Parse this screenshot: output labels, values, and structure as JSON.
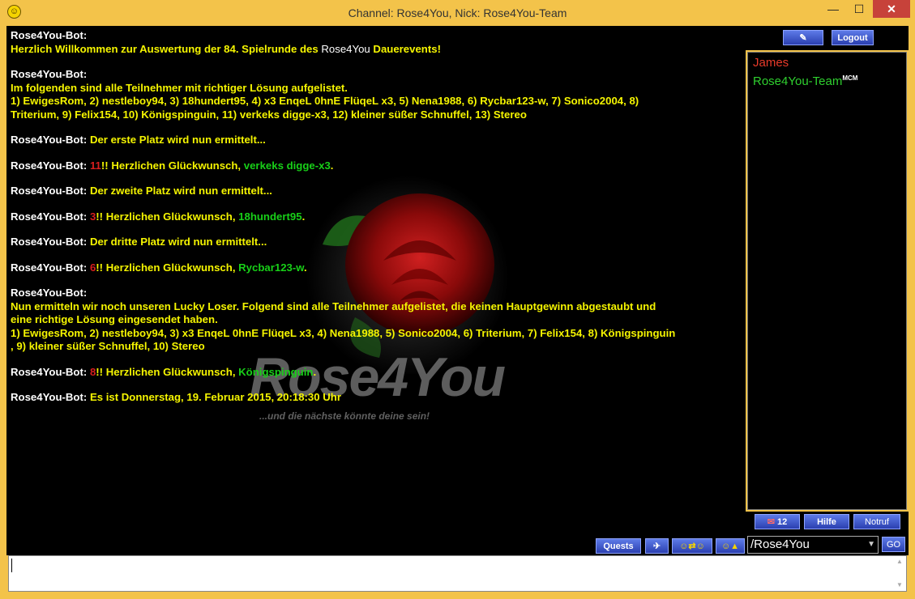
{
  "window": {
    "title": "Channel: Rose4You,  Nick: Rose4You-Team",
    "app_icon": "smiley-icon"
  },
  "window_controls": {
    "minimize": "—",
    "maximize": "☐",
    "close": "✕"
  },
  "chat": {
    "m1": {
      "sender": "Rose4You-Bot:",
      "t1": "Herzlich Willkommen zur Auswertung der  84. Spielrunde des ",
      "brand": "Rose4You",
      "t2": " Dauerevents!"
    },
    "m2": {
      "sender": "Rose4You-Bot:",
      "l1": "Im folgenden sind alle Teilnehmer mit richtiger Lösung aufgelistet.",
      "l2": "1) EwigesRom, 2) nestleboy94, 3) 18hundert95, 4) x3 EnqeL 0hnE FlüqeL x3, 5) Nena1988, 6) Rycbar123-w, 7) Sonico2004, 8)",
      "l3": "Triterium, 9) Felix154, 10) Königspinguin, 11) verkeks digge-x3, 12) kleiner süßer Schnuffel, 13) Stereo"
    },
    "m3": {
      "sender": "Rose4You-Bot: ",
      "text": "Der erste Platz wird nun ermittelt..."
    },
    "m4": {
      "sender": "Rose4You-Bot: ",
      "num": "11",
      "text": "!! Herzlichen Glückwunsch, ",
      "winner": "verkeks digge-x3",
      "end": "."
    },
    "m5": {
      "sender": "Rose4You-Bot: ",
      "text": "Der zweite Platz wird nun ermittelt..."
    },
    "m6": {
      "sender": "Rose4You-Bot: ",
      "num": "3",
      "text": "!! Herzlichen Glückwunsch, ",
      "winner": "18hundert95",
      "end": "."
    },
    "m7": {
      "sender": "Rose4You-Bot: ",
      "text": "Der dritte Platz wird nun ermittelt..."
    },
    "m8": {
      "sender": "Rose4You-Bot: ",
      "num": "6",
      "text": "!! Herzlichen Glückwunsch, ",
      "winner": "Rycbar123-w",
      "end": "."
    },
    "m9": {
      "sender": "Rose4You-Bot:",
      "l1": "Nun ermitteln wir noch unseren Lucky Loser. Folgend sind alle Teilnehmer aufgelistet, die keinen Hauptgewinn abgestaubt und",
      "l2": "eine richtige Lösung eingesendet haben.",
      "l3": "1) EwigesRom, 2) nestleboy94, 3) x3 EnqeL 0hnE FlüqeL x3, 4) Nena1988, 5) Sonico2004, 6) Triterium, 7) Felix154, 8) Königspinguin",
      "l4": ", 9) kleiner süßer Schnuffel, 10) Stereo"
    },
    "m10": {
      "sender": "Rose4You-Bot: ",
      "num": "8",
      "text": "!! Herzlichen Glückwunsch, ",
      "winner": "Königspinguin",
      "end": "."
    },
    "m11": {
      "sender": "Rose4You-Bot: ",
      "text": "Es ist Donnerstag, 19. Februar 2015, 20:18:30 Uhr"
    }
  },
  "watermark": {
    "logo": "Rose4You",
    "slogan": "...und die nächste könnte deine sein!"
  },
  "chat_toolbar": {
    "quests": "Quests",
    "plane_icon": "airplane-icon",
    "smileys_icon": "smileys-exchange-icon",
    "smiley_up_icon": "smiley-up-icon"
  },
  "side": {
    "logout": "Logout",
    "top_icon": "feather-pen-icon",
    "users": [
      {
        "name": "James",
        "color": "#e83a2a",
        "badge": ""
      },
      {
        "name": "Rose4You-Team",
        "color": "#2fd02f",
        "badge": "MCM"
      }
    ],
    "messages_count": "12",
    "mail_icon": "envelope-icon",
    "help": "Hilfe",
    "emergency": "Notruf",
    "channel_select": "/Rose4You",
    "go": "GO"
  },
  "input": {
    "value": ""
  }
}
